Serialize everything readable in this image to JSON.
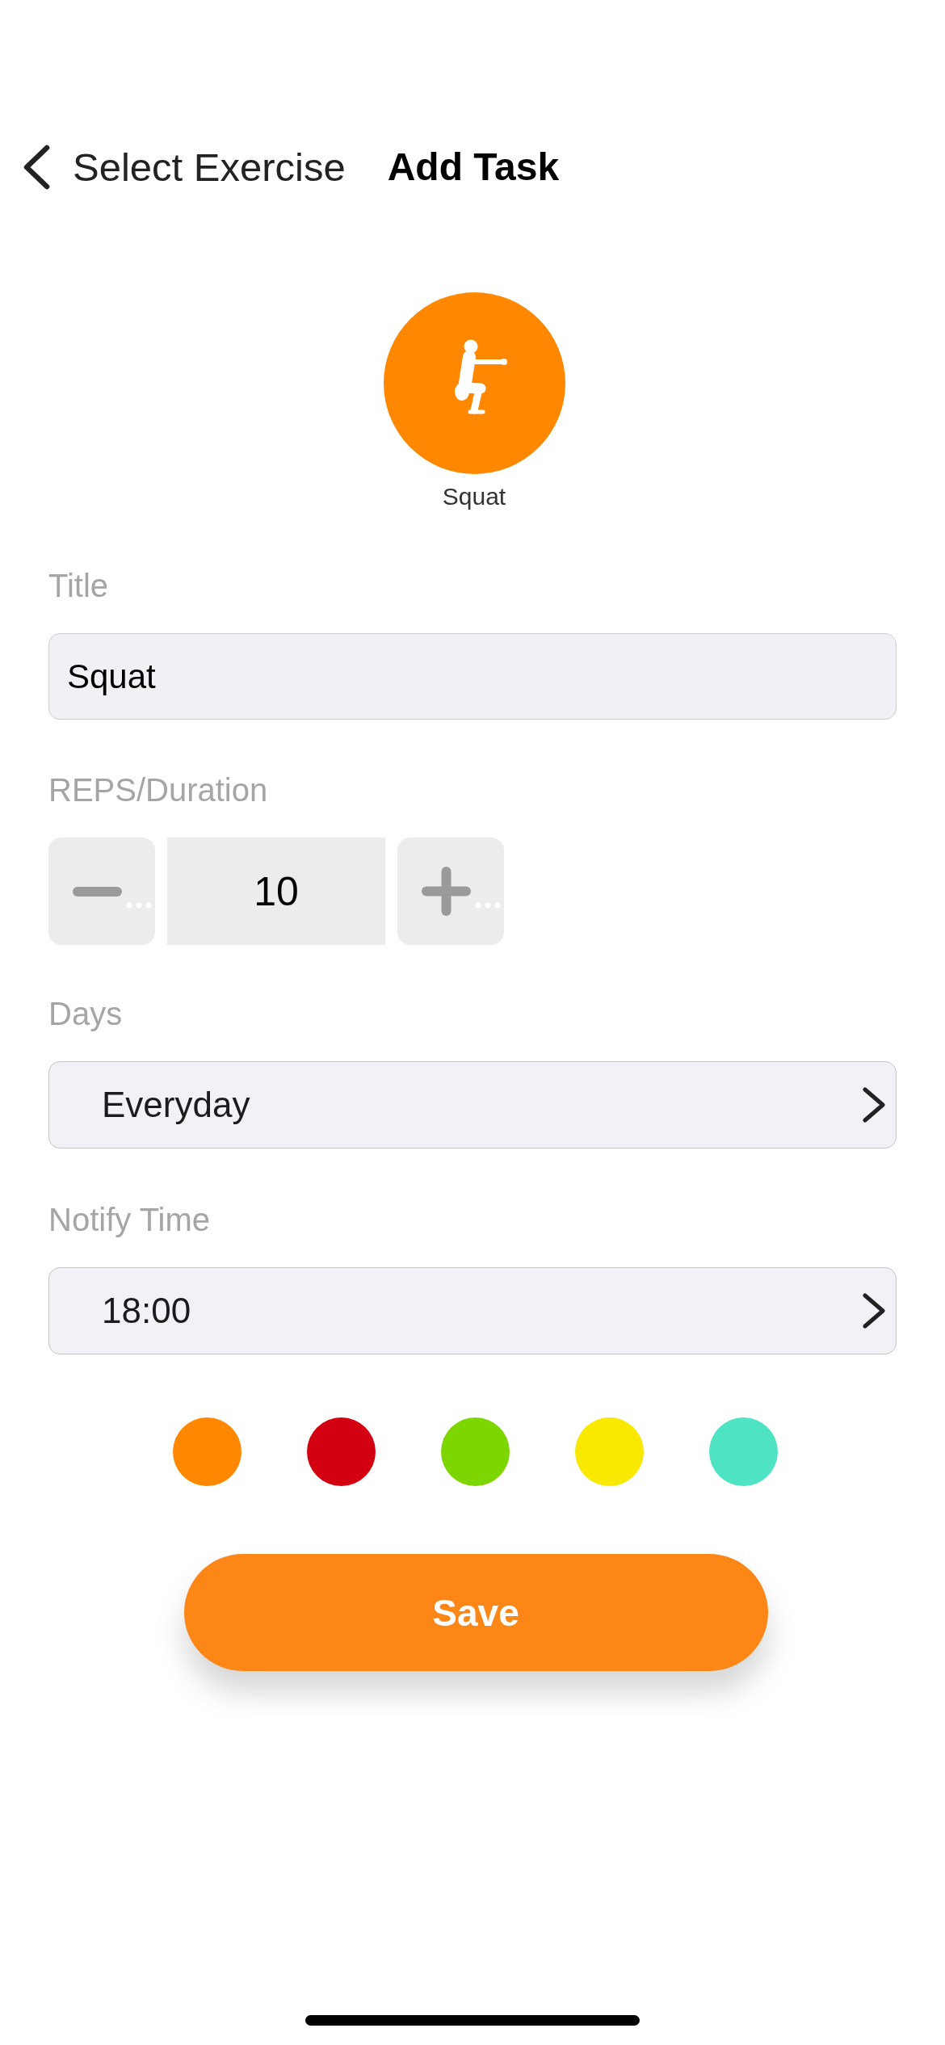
{
  "nav": {
    "back_label": "Select Exercise",
    "title": "Add Task"
  },
  "exercise": {
    "name": "Squat"
  },
  "form": {
    "title": {
      "label": "Title",
      "value": "Squat"
    },
    "reps": {
      "label": "REPS/Duration",
      "value": "10"
    },
    "days": {
      "label": "Days",
      "value": "Everyday"
    },
    "notify_time": {
      "label": "Notify Time",
      "value": "18:00"
    }
  },
  "colors": [
    {
      "color": "#ff8800"
    },
    {
      "color": "#d20010"
    },
    {
      "color": "#7ed600"
    },
    {
      "color": "#f9e900"
    },
    {
      "color": "#4de3c3"
    }
  ],
  "save_button": {
    "label": "Save"
  }
}
